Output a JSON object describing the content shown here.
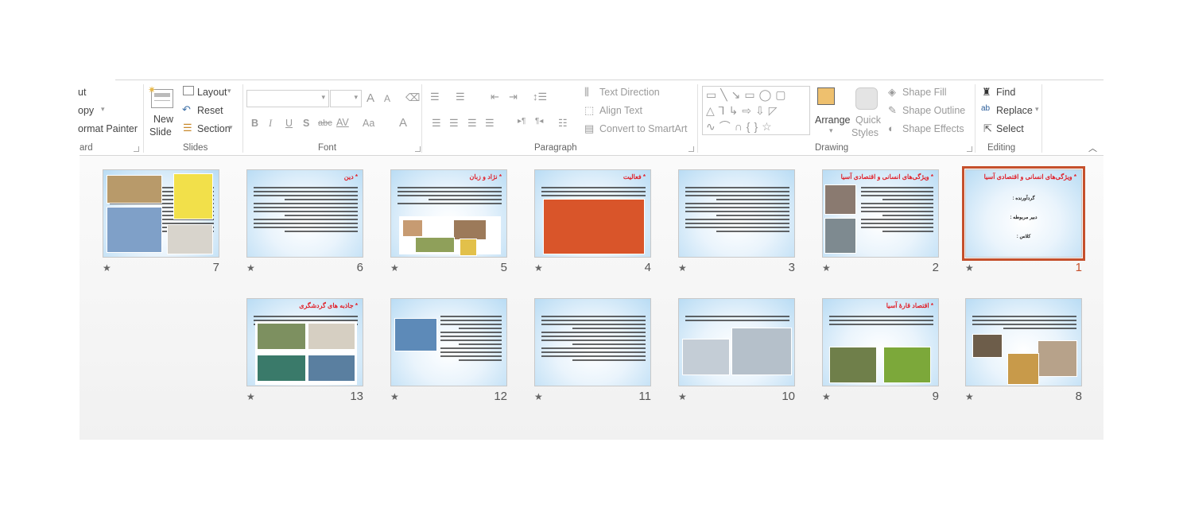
{
  "ribbon": {
    "clipboard": {
      "cut": "ut",
      "copy": "opy",
      "format_painter": "ormat Painter",
      "label": "ard"
    },
    "slides": {
      "new_slide_line1": "New",
      "new_slide_line2": "Slide",
      "layout": "Layout",
      "reset": "Reset",
      "section": "Section",
      "label": "Slides"
    },
    "font": {
      "bold": "B",
      "italic": "I",
      "underline": "U",
      "shadow": "S",
      "strike": "abc",
      "spacing": "AV",
      "case": "Aa",
      "color": "A",
      "grow": "A",
      "shrink": "A",
      "label": "Font"
    },
    "paragraph": {
      "text_direction": "Text Direction",
      "align_text": "Align Text",
      "convert_smartart": "Convert to SmartArt",
      "label": "Paragraph"
    },
    "drawing": {
      "arrange": "Arrange",
      "quick_styles_line1": "Quick",
      "quick_styles_line2": "Styles",
      "shape_fill": "Shape Fill",
      "shape_outline": "Shape Outline",
      "shape_effects": "Shape Effects",
      "label": "Drawing"
    },
    "editing": {
      "find": "Find",
      "replace": "Replace",
      "select": "Select",
      "label": "Editing"
    }
  },
  "slides": [
    {
      "number": "1",
      "title": "ویژگی‌های انسانی و اقتصادی آسیا",
      "selected": true,
      "lines": [
        "گردآورنده :",
        "دبیر مربوطه :",
        "کلاس :"
      ]
    },
    {
      "number": "2",
      "title": "ویژگی‌های انسانی و اقتصادی آسیا"
    },
    {
      "number": "3",
      "title": ""
    },
    {
      "number": "4",
      "title": "فعالیت"
    },
    {
      "number": "5",
      "title": "نژاد و زبان"
    },
    {
      "number": "6",
      "title": "دین"
    },
    {
      "number": "7",
      "title": ""
    },
    {
      "number": "8",
      "title": ""
    },
    {
      "number": "9",
      "title": "اقتصاد قارهٔ آسیا"
    },
    {
      "number": "10",
      "title": ""
    },
    {
      "number": "11",
      "title": ""
    },
    {
      "number": "12",
      "title": ""
    },
    {
      "number": "13",
      "title": "جاذبه های گردشگری"
    }
  ],
  "colors": {
    "selection": "#c5502c",
    "title_red": "#e0202a"
  }
}
